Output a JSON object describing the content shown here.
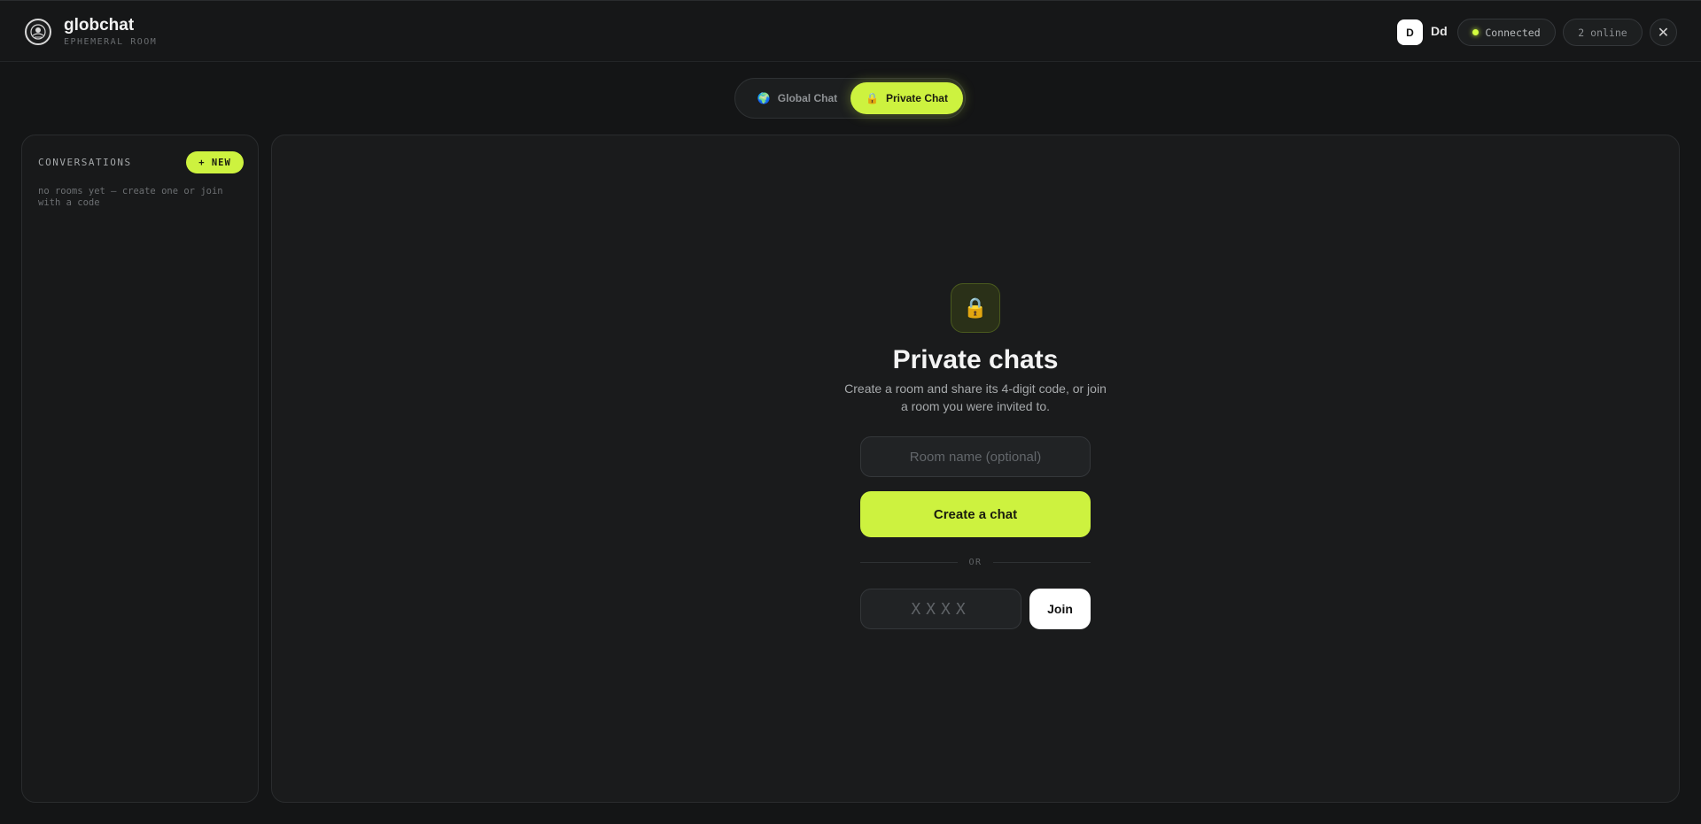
{
  "header": {
    "brand_name": "globchat",
    "brand_sub": "EPHEMERAL ROOM",
    "logo_icon": "globe-emblem-icon",
    "avatar_initial": "D",
    "user_name": "Dd",
    "status_label": "Connected",
    "online_count": "2 online",
    "close_icon": "✕"
  },
  "tabs": [
    {
      "icon": "🌍",
      "label": "Global Chat",
      "active": false
    },
    {
      "icon": "🔒",
      "label": "Private Chat",
      "active": true
    }
  ],
  "sidebar": {
    "title": "CONVERSATIONS",
    "new_button": "+ NEW",
    "empty_text": "no rooms yet — create one or join with a code"
  },
  "main": {
    "lock_icon": "🔒",
    "title": "Private chats",
    "description": "Create a room and share its 4-digit code, or join a room you were invited to.",
    "room_name_placeholder": "Room name (optional)",
    "create_button": "Create a chat",
    "or_label": "OR",
    "code_placeholder": "XXXX",
    "join_button": "Join"
  },
  "colors": {
    "accent": "#cdf23f",
    "background": "#141516",
    "panel": "#1a1b1c",
    "status_dot": "#d4ff3f"
  }
}
